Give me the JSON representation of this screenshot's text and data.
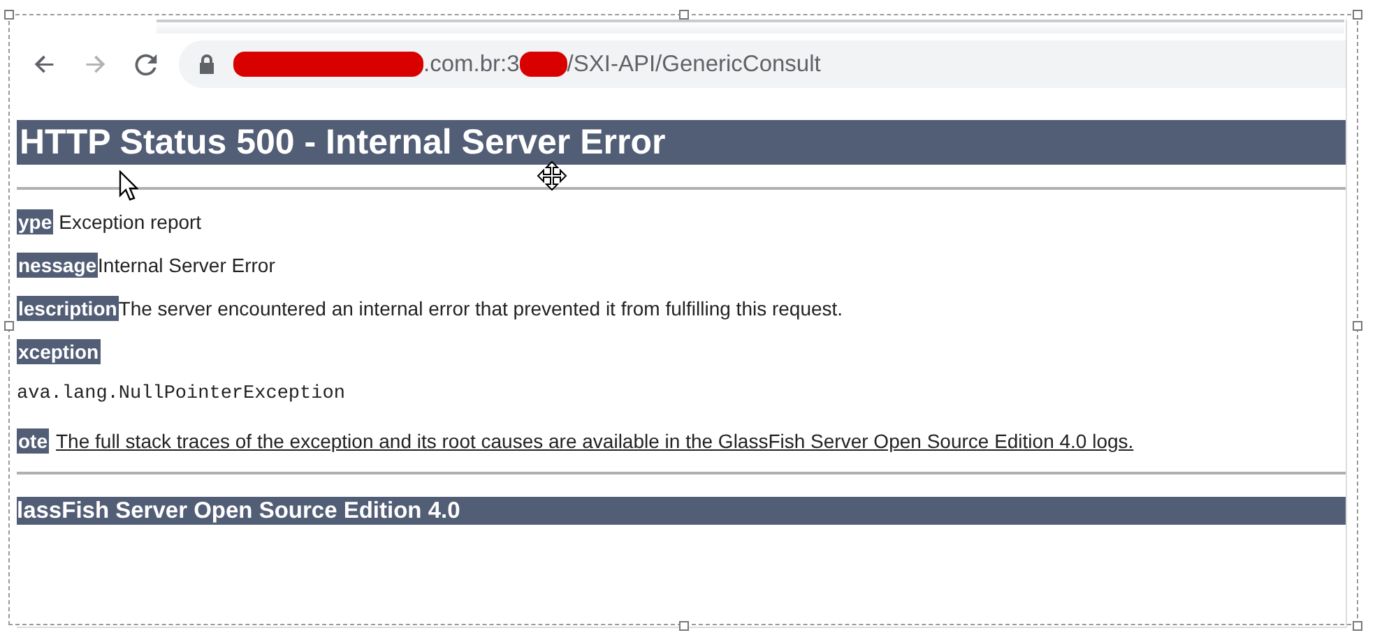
{
  "browser": {
    "nav_buttons": [
      {
        "kind": "back",
        "disabled": false
      },
      {
        "kind": "forward",
        "disabled": true
      },
      {
        "kind": "reload",
        "disabled": false
      }
    ],
    "url_parts": [
      {
        "kind": "redacted"
      },
      {
        "kind": "text",
        "text": ".com.br:3"
      },
      {
        "kind": "redacted"
      },
      {
        "kind": "text",
        "text": "/SXI-API/GenericConsult"
      }
    ]
  },
  "page": {
    "heading": "HTTP Status 500 - Internal Server Error",
    "blocks": [
      {
        "kind": "field",
        "label": "ype",
        "value": "Exception report"
      },
      {
        "kind": "field",
        "label": "nessage",
        "value": "Internal Server Error"
      },
      {
        "kind": "field",
        "label": "lescription",
        "value": "The server encountered an internal error that prevented it from fulfilling this request."
      },
      {
        "kind": "field",
        "label": "xception"
      },
      {
        "kind": "code",
        "text": "ava.lang.NullPointerException"
      },
      {
        "kind": "note",
        "label": "ote",
        "value": "The full stack traces of the exception and its root causes are available in the GlassFish Server Open Source Edition 4.0 logs."
      }
    ],
    "footer": "lassFish Server Open Source Edition 4.0"
  }
}
